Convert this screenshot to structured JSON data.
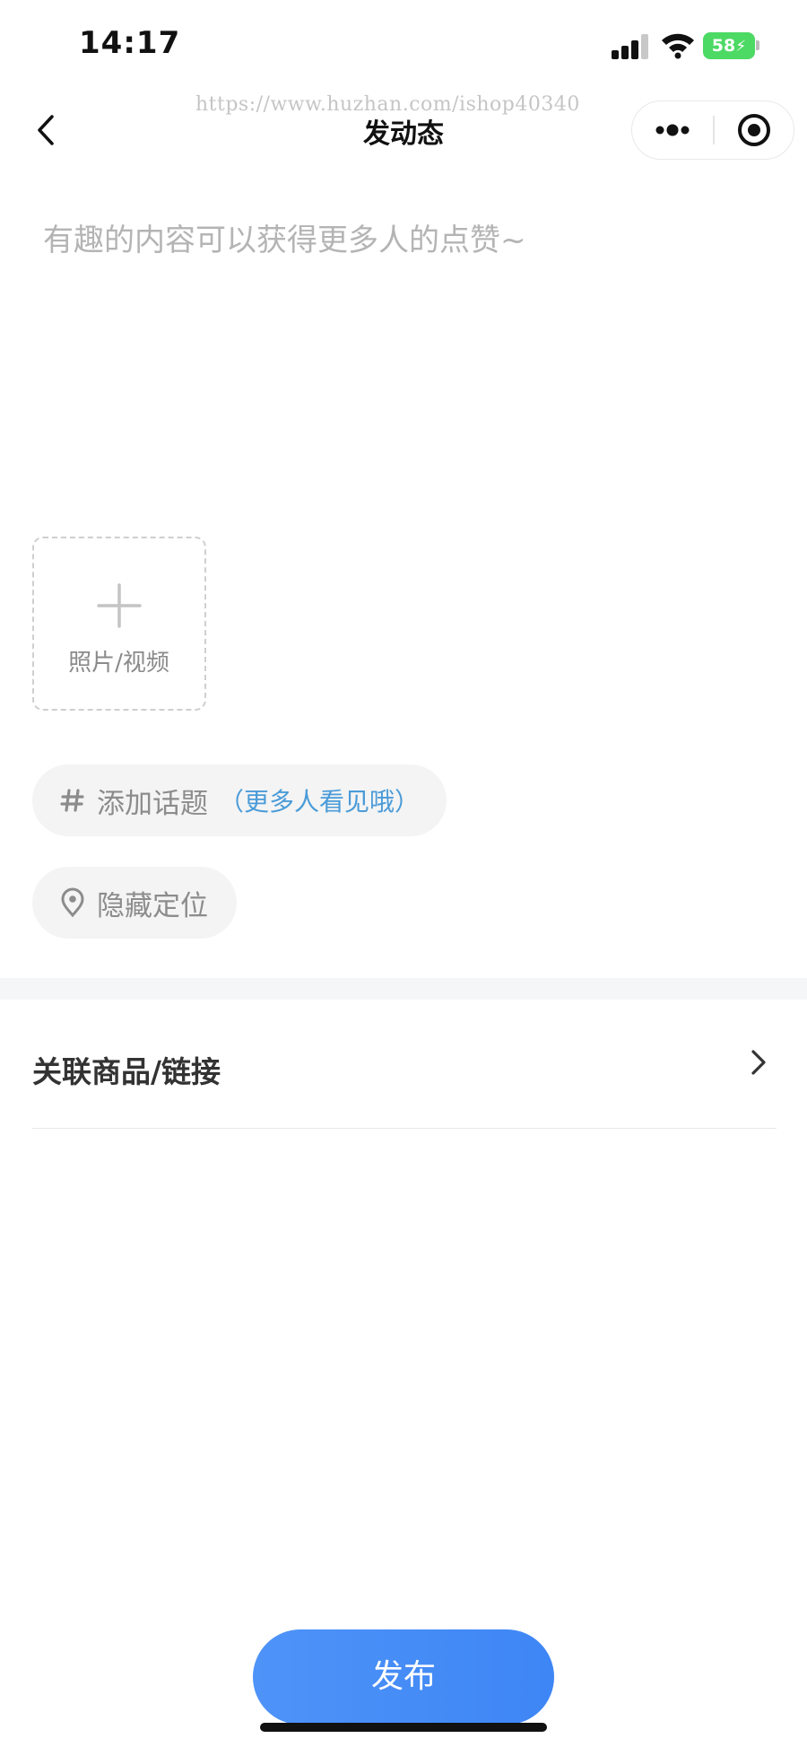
{
  "status_bar": {
    "time": "14:17",
    "battery": "58"
  },
  "nav": {
    "watermark": "https://www.huzhan.com/ishop40340",
    "title": "发动态"
  },
  "composer": {
    "placeholder": "有趣的内容可以获得更多人的点赞~"
  },
  "upload": {
    "label": "照片/视频"
  },
  "topic": {
    "icon": "hash-icon",
    "label": "添加话题",
    "hint": "（更多人看见哦）"
  },
  "location": {
    "icon": "location-pin-icon",
    "label": "隐藏定位"
  },
  "link_row": {
    "label": "关联商品/链接"
  },
  "publish": {
    "label": "发布"
  },
  "colors": {
    "accent": "#4a8ff7",
    "hint_blue": "#4a9bd8",
    "battery_green": "#4cd964"
  }
}
